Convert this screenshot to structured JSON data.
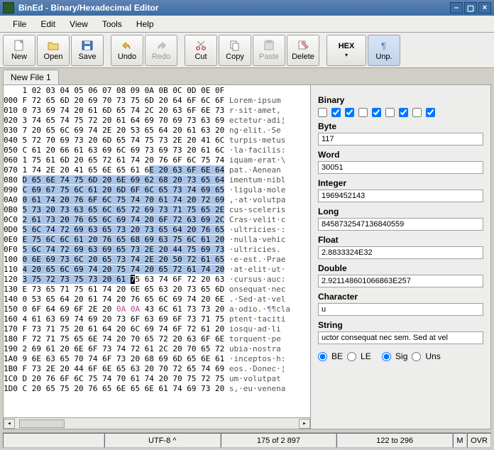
{
  "title": "BinEd - Binary/Hexadecimal Editor",
  "menu": [
    "File",
    "Edit",
    "View",
    "Tools",
    "Help"
  ],
  "toolbar": {
    "new": "New",
    "open": "Open",
    "save": "Save",
    "undo": "Undo",
    "redo": "Redo",
    "cut": "Cut",
    "copy": "Copy",
    "paste": "Paste",
    "delete": "Delete",
    "hex": "HEX",
    "unp": "Unp."
  },
  "tab": "New File 1",
  "hexHeader": "    1 02 03 04 05 06 07 08 09 0A 0B 0C 0D 0E 0F",
  "hexRows": [
    {
      "addr": "000",
      "hex": "F 72 65 6D 20 69 70 73 75 6D 20 64 6F 6C 6F",
      "asc": "Lorem·ipsum"
    },
    {
      "addr": "010",
      "hex": "0 73 69 74 20 61 6D 65 74 2C 20 63 6F 6E 73",
      "asc": "r·sit·amet,"
    },
    {
      "addr": "020",
      "hex": "3 74 65 74 75 72 20 61 64 69 70 69 73 63 69",
      "asc": "ectetur·adi¦"
    },
    {
      "addr": "030",
      "hex": "7 20 65 6C 69 74 2E 20 53 65 64 20 61 63 20",
      "asc": "ng·elit.·Se"
    },
    {
      "addr": "040",
      "hex": "5 72 70 69 73 20 6D 65 74 75 73 2E 20 41 6C",
      "asc": "turpis·metus"
    },
    {
      "addr": "050",
      "hex": "C 61 20 66 61 63 69 6C 69 73 69 73 20 61 6C",
      "asc": "·la·facilis:"
    },
    {
      "addr": "060",
      "hex": "1 75 61 6D 20 65 72 61 74 20 76 6F 6C 75 74",
      "asc": "iquam·erat·\\"
    },
    {
      "addr": "070",
      "hex": "1 74 2E 20 41 65 6E 65 61 6E 20 63 6F 6E 64",
      "asc": "pat.·Aenean",
      "selStart": 9
    },
    {
      "addr": "080",
      "hex": "D 65 6E 74 75 6D 20 6E 69 62 68 20 73 65 64",
      "asc": "imentum·nibl",
      "selAll": true
    },
    {
      "addr": "090",
      "hex": "C 69 67 75 6C 61 20 6D 6F 6C 65 73 74 69 65",
      "asc": "·ligula·mole",
      "selAll": true
    },
    {
      "addr": "0A0",
      "hex": "0 61 74 20 76 6F 6C 75 74 70 61 74 20 72 69",
      "asc": ",·at·volutpa",
      "selAll": true
    },
    {
      "addr": "0B0",
      "hex": "5 73 20 73 63 65 6C 65 72 69 73 71 75 65 2E",
      "asc": "cus·sceleris",
      "selAll": true
    },
    {
      "addr": "0C0",
      "hex": "2 61 73 20 76 65 6C 69 74 20 6F 72 63 69 2C",
      "asc": "Cras·velit·c",
      "selAll": true
    },
    {
      "addr": "0D0",
      "hex": "5 6C 74 72 69 63 65 73 20 73 65 64 20 76 65",
      "asc": "·ultricies·:",
      "selAll": true
    },
    {
      "addr": "0E0",
      "hex": "E 75 6C 6C 61 20 76 65 68 69 63 75 6C 61 20",
      "asc": "·nulla·vehic",
      "selAll": true
    },
    {
      "addr": "0F0",
      "hex": "5 6C 74 72 69 63 69 65 73 2E 20 44 75 69 73",
      "asc": "·ultricies.",
      "selAll": true
    },
    {
      "addr": "100",
      "hex": "0 6E 69 73 6C 20 65 73 74 2E 20 50 72 61 65",
      "asc": "·e·est.·Prae",
      "selAll": true
    },
    {
      "addr": "110",
      "hex": "4 20 65 6C 69 74 20 75 74 20 65 72 61 74 20",
      "asc": "·at·elit·ut·",
      "selAll": true
    },
    {
      "addr": "120",
      "hex": "3 75 72 73 75 73 20 61 ",
      "cursor": "7",
      "hex2": "5 63 74 6F 72 20 63",
      "asc": "·cursus·auc:",
      "selStartOnly": 8
    },
    {
      "addr": "130",
      "hex": "E 73 65 71 75 61 74 20 6E 65 63 20 73 65 6D",
      "asc": "onsequat·nec"
    },
    {
      "addr": "140",
      "hex": "0 53 65 64 20 61 74 20 76 65 6C 69 74 20 6E",
      "asc": ".·Sed·at·vel"
    },
    {
      "addr": "150",
      "hex": "0 6F 64 69 6F 2E 20 ",
      "pink": "0A 0A",
      "hex2": " 43 6C 61 73 73 20",
      "asc": "a·odio.·",
      "para": "¶¶",
      "asc2": "cla"
    },
    {
      "addr": "160",
      "hex": "4 61 63 69 74 69 20 73 6F 63 69 6F 73 71 75",
      "asc": "ptent·taciti"
    },
    {
      "addr": "170",
      "hex": "F 73 71 75 20 61 64 20 6C 69 74 6F 72 61 20",
      "asc": "iosqu·ad·li"
    },
    {
      "addr": "180",
      "hex": "F 72 71 75 65 6E 74 20 70 65 72 20 63 6F 6E",
      "asc": "torquent·pe"
    },
    {
      "addr": "190",
      "hex": "2 69 61 20 6E 6F 73 74 72 61 2C 20 70 65 72",
      "asc": "ubia·nostra"
    },
    {
      "addr": "1A0",
      "hex": "9 6E 63 65 70 74 6F 73 20 68 69 6D 65 6E 61",
      "asc": "·inceptos·h:"
    },
    {
      "addr": "1B0",
      "hex": "F 73 2E 20 44 6F 6E 65 63 20 70 72 65 74 69",
      "asc": "eos.·Donec·¦"
    },
    {
      "addr": "1C0",
      "hex": "D 20 76 6F 6C 75 74 70 61 74 20 70 75 72 75",
      "asc": "um·volutpat"
    },
    {
      "addr": "1D0",
      "hex": "C 20 65 75 20 76 65 6E 65 6E 61 74 69 73 20",
      "asc": "s,·eu·venena"
    }
  ],
  "inspector": {
    "binaryLabel": "Binary",
    "byteLabel": "Byte",
    "byte": "117",
    "wordLabel": "Word",
    "word": "30051",
    "intLabel": "Integer",
    "int": "1969452143",
    "longLabel": "Long",
    "long": "8458732547136840559",
    "floatLabel": "Float",
    "float": "2.8833324E32",
    "doubleLabel": "Double",
    "double": "2.921148601066863E257",
    "charLabel": "Character",
    "char": "u",
    "stringLabel": "String",
    "string": "uctor consequat nec sem. Sed at vel",
    "be": "BE",
    "le": "LE",
    "sig": "Sig",
    "uns": "Uns"
  },
  "binaryChecks": [
    false,
    true,
    true,
    false,
    true,
    false,
    true,
    false,
    true
  ],
  "status": {
    "encoding": "UTF-8 ^",
    "pos": "175 of 2 897",
    "sel": "122 to 296",
    "mode": "M",
    "ovr": "OVR"
  }
}
